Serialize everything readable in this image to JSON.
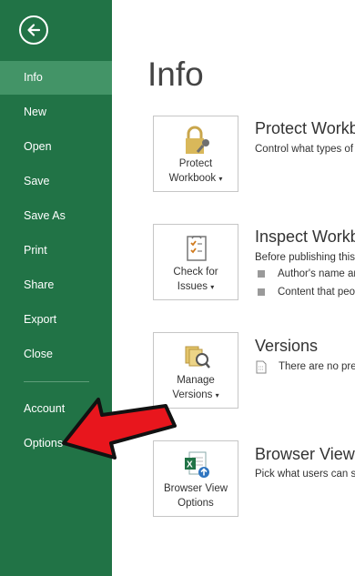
{
  "nav": {
    "items": [
      {
        "label": "Info",
        "active": true
      },
      {
        "label": "New"
      },
      {
        "label": "Open"
      },
      {
        "label": "Save"
      },
      {
        "label": "Save As"
      },
      {
        "label": "Print"
      },
      {
        "label": "Share"
      },
      {
        "label": "Export"
      },
      {
        "label": "Close"
      },
      {
        "label": "Account"
      },
      {
        "label": "Options"
      }
    ],
    "back_icon": "back-arrow-icon"
  },
  "main": {
    "title": "Info",
    "sections": [
      {
        "tile_label_1": "Protect",
        "tile_label_2": "Workbook",
        "tile_icon": "lock-key-icon",
        "title": "Protect Workbook",
        "desc": "Control what types of changes people can make to this workbook."
      },
      {
        "tile_label_1": "Check for",
        "tile_label_2": "Issues",
        "tile_icon": "checklist-icon",
        "title": "Inspect Workbook",
        "desc": "Before publishing this file, be aware that it contains:",
        "bullets": [
          "Author's name and absolute path",
          "Content that people with disabilities find difficult to read"
        ]
      },
      {
        "tile_label_1": "Manage",
        "tile_label_2": "Versions",
        "tile_icon": "versions-icon",
        "title": "Versions",
        "desc": "There are no previous versions of this file."
      },
      {
        "tile_label_1": "Browser View",
        "tile_label_2": "Options",
        "tile_icon": "excel-browser-icon",
        "title": "Browser View Options",
        "desc": "Pick what users can see when this workbook is viewed on the Web."
      }
    ]
  },
  "colors": {
    "sidebar": "#217346",
    "sidebar_active": "#439467",
    "annotation_arrow": "#e8161d"
  }
}
